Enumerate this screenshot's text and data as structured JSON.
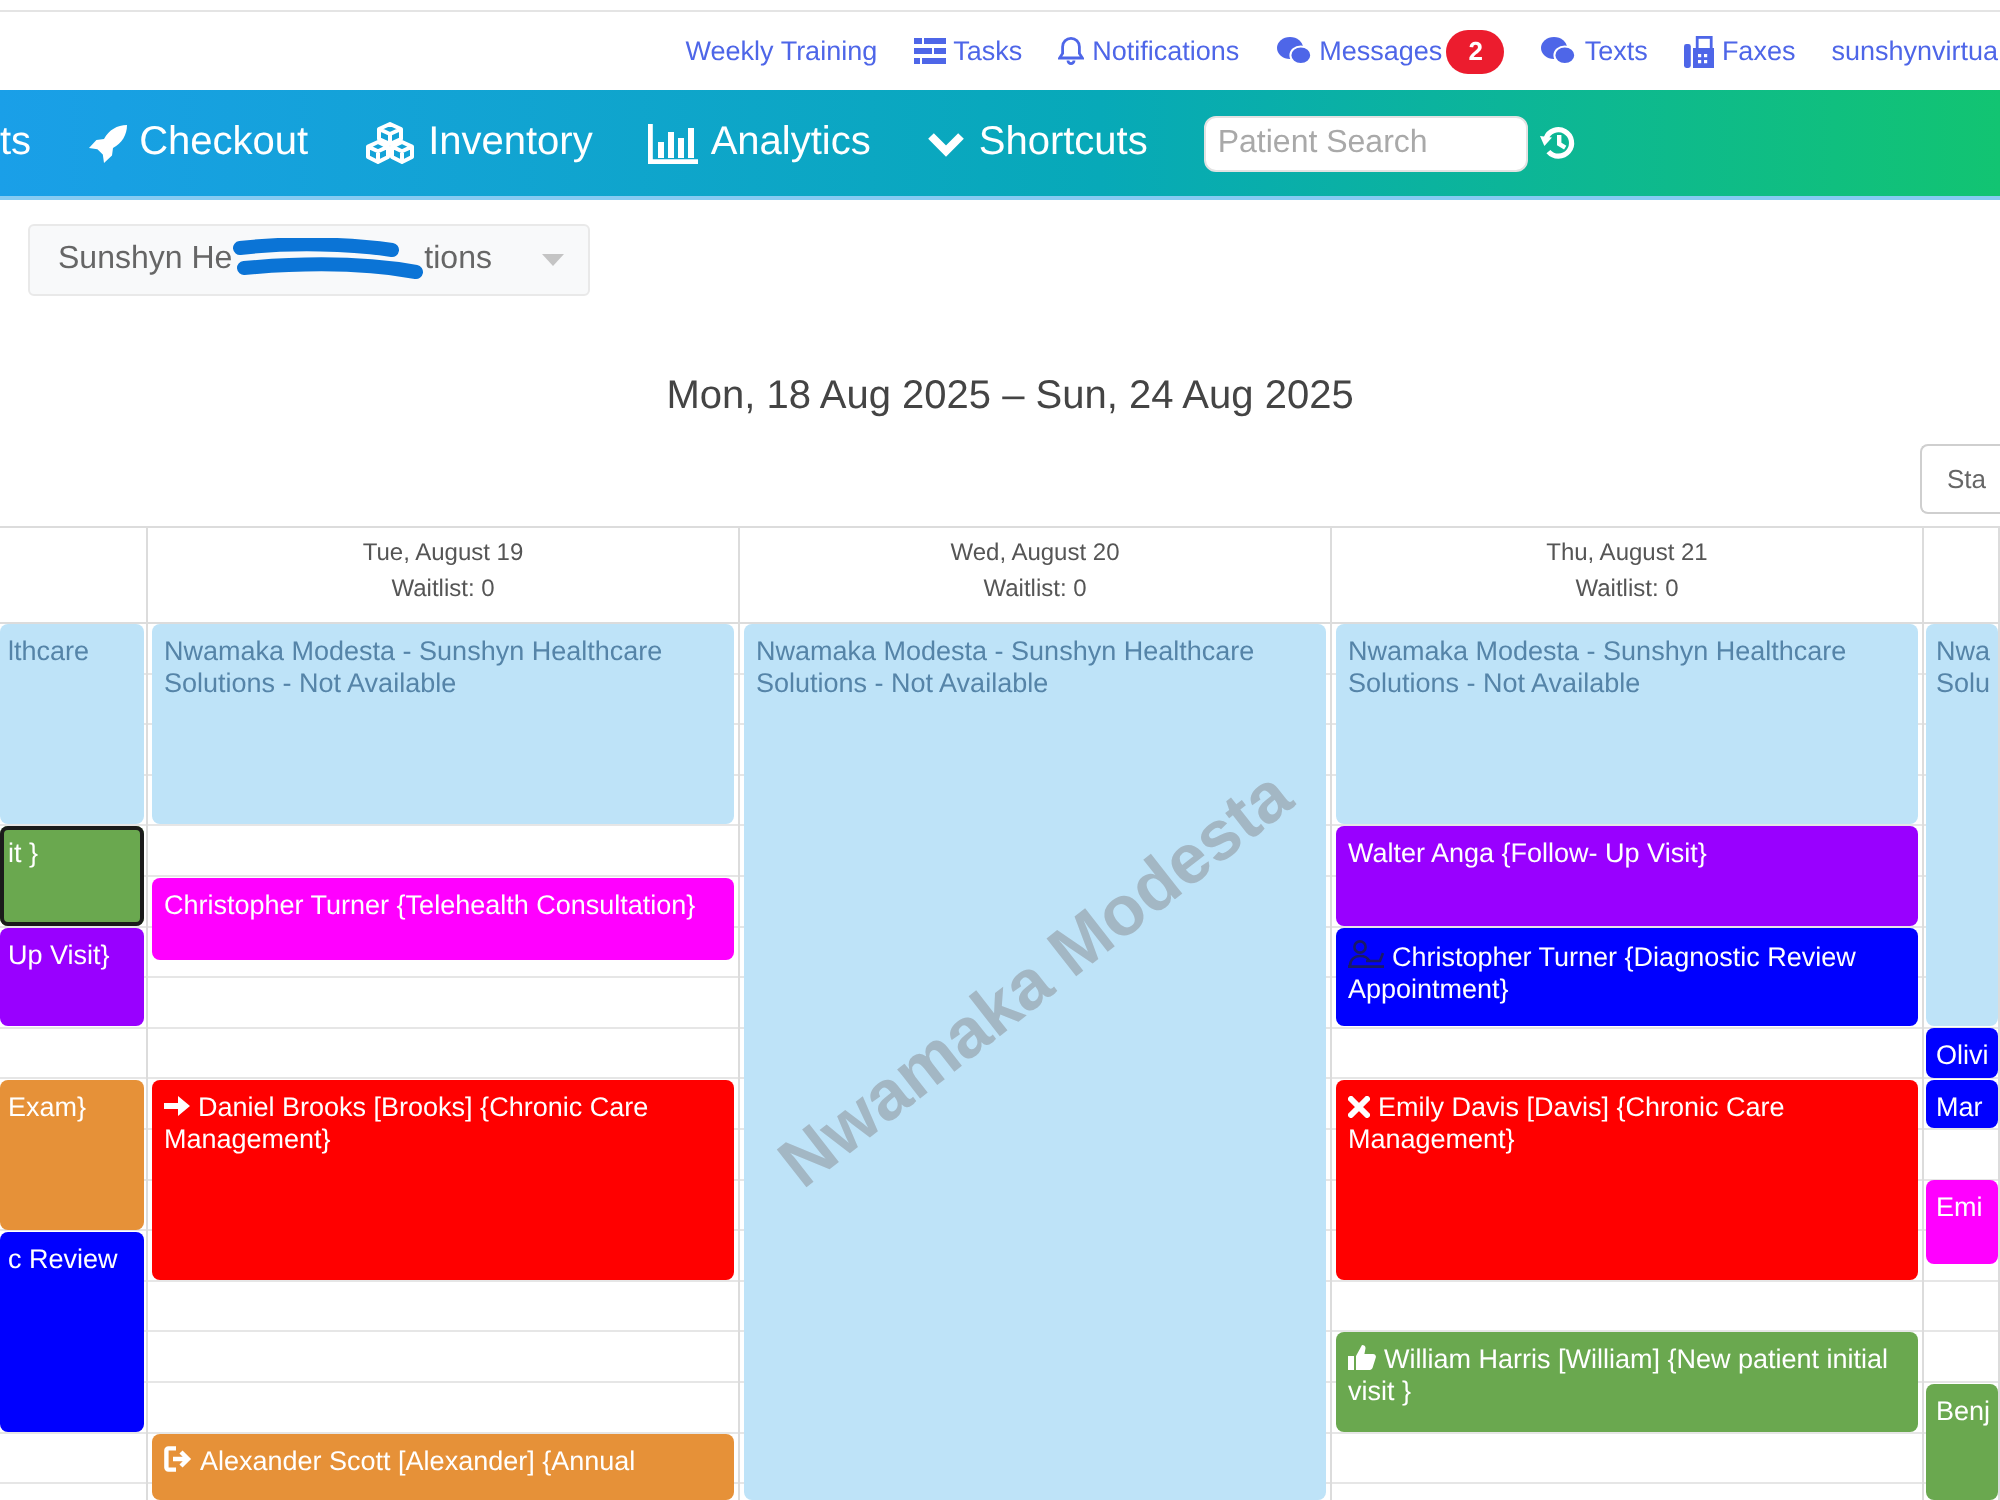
{
  "top_links": [
    {
      "label": "Weekly Training"
    },
    {
      "label": "Tasks"
    },
    {
      "label": "Notifications"
    },
    {
      "label": "Messages",
      "badge": "2"
    },
    {
      "label": "Texts"
    },
    {
      "label": "Faxes"
    },
    {
      "label": "sunshynvirtua"
    }
  ],
  "nav": {
    "items": [
      {
        "label": "ts"
      },
      {
        "label": "Checkout"
      },
      {
        "label": "Inventory"
      },
      {
        "label": "Analytics"
      },
      {
        "label": "Shortcuts"
      }
    ],
    "search": {
      "placeholder": "Patient Search"
    }
  },
  "location_select": {
    "visible_text": [
      "Sunshyn He",
      "tions"
    ]
  },
  "calendar": {
    "range_title": "Mon, 18 Aug 2025 – Sun, 24 Aug 2025",
    "view_button": "Sta",
    "columns": [
      {
        "events": [
          {
            "title": "lthcare",
            "kind": "unavailable",
            "color": "#bee3f8",
            "selected": false
          },
          {
            "title": "it }",
            "kind": "plain",
            "color": "#6aa84f",
            "selected": true
          },
          {
            "title": "Up Visit}",
            "kind": "plain",
            "color": "#9900ff",
            "selected": false
          },
          {
            "title": "Exam}",
            "kind": "plain",
            "color": "#e69138",
            "selected": false
          },
          {
            "title": "c Review",
            "kind": "plain",
            "color": "#0000ff",
            "selected": false
          }
        ]
      },
      {
        "date": "Tue, August 19",
        "waitlist": "Waitlist: 0",
        "events": [
          {
            "title": "Nwamaka Modesta - Sunshyn Healthcare Solutions - Not Available",
            "kind": "unavailable",
            "color": "#bee3f8",
            "selected": false
          },
          {
            "title": "Christopher Turner {Telehealth Consultation}",
            "kind": "plain",
            "color": "#ff00ff",
            "selected": false
          },
          {
            "title": "Daniel Brooks [Brooks] {Chronic Care Management}",
            "kind": "arrow",
            "color": "#ff0000",
            "selected": false
          },
          {
            "title": "Alexander Scott [Alexander] {Annual",
            "kind": "exit",
            "color": "#e69138",
            "selected": false
          }
        ]
      },
      {
        "date": "Wed, August 20",
        "waitlist": "Waitlist: 0",
        "watermark": "Nwamaka Modesta",
        "events": [
          {
            "title": "Nwamaka Modesta - Sunshyn Healthcare Solutions - Not Available",
            "kind": "unavailable",
            "color": "#bee3f8",
            "selected": false
          }
        ]
      },
      {
        "date": "Thu, August 21",
        "waitlist": "Waitlist: 0",
        "events": [
          {
            "title": "Nwamaka Modesta - Sunshyn Healthcare Solutions - Not Available",
            "kind": "unavailable",
            "color": "#bee3f8",
            "selected": false
          },
          {
            "title": "Walter Anga {Follow- Up Visit}",
            "kind": "plain",
            "color": "#9900ff",
            "selected": false
          },
          {
            "title": "Christopher Turner {Diagnostic Review Appointment}",
            "kind": "person",
            "color": "#0000ff",
            "selected": false
          },
          {
            "title": "Emily Davis [Davis] {Chronic Care Management}",
            "kind": "cross",
            "color": "#ff0000",
            "selected": false
          },
          {
            "title": "William Harris [William] {New patient initial visit }",
            "kind": "thumb",
            "color": "#6aa84f",
            "selected": false
          }
        ]
      },
      {
        "events": [
          {
            "title": "Nwa Solu",
            "kind": "unavailable",
            "color": "#bee3f8",
            "selected": false
          },
          {
            "title": "Olivi",
            "kind": "plain",
            "color": "#0000ff",
            "selected": false
          },
          {
            "title": "Mar",
            "kind": "plain",
            "color": "#0000ff",
            "selected": false
          },
          {
            "title": "Emi",
            "kind": "plain",
            "color": "#ff00ff",
            "selected": false
          },
          {
            "title": "Benj",
            "kind": "plain",
            "color": "#6aa84f",
            "selected": false
          }
        ]
      }
    ]
  }
}
